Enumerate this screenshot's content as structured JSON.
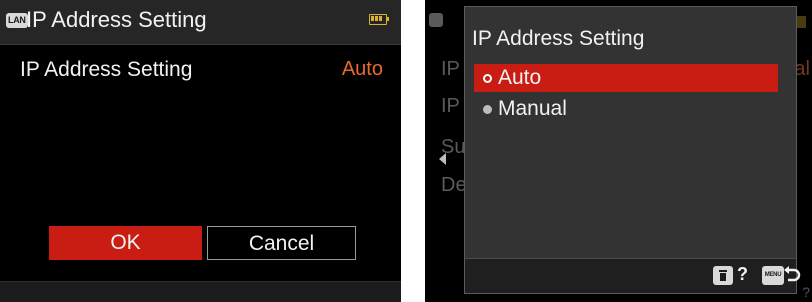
{
  "left_screen": {
    "lan_badge": "LAN",
    "title": "IP Address Setting",
    "setting": {
      "label": "IP Address Setting",
      "value": "Auto"
    },
    "buttons": {
      "ok": "OK",
      "cancel": "Cancel"
    },
    "colors": {
      "accent": "#c91d13",
      "value_text": "#e8692b",
      "background": "#000000"
    }
  },
  "right_screen": {
    "background_fragments": {
      "ip1": "IP",
      "ip2": "IP",
      "su": "Su",
      "de": "De",
      "ual": "ual"
    },
    "popup": {
      "title": "IP Address Setting",
      "options": [
        {
          "label": "Auto",
          "selected": true
        },
        {
          "label": "Manual",
          "selected": false
        }
      ],
      "footer": {
        "trash_key_icon": "trash-icon",
        "help_label": "?",
        "menu_key": "MENU",
        "back_icon": "back-arrow-icon"
      }
    },
    "corner_fragment": "?"
  }
}
